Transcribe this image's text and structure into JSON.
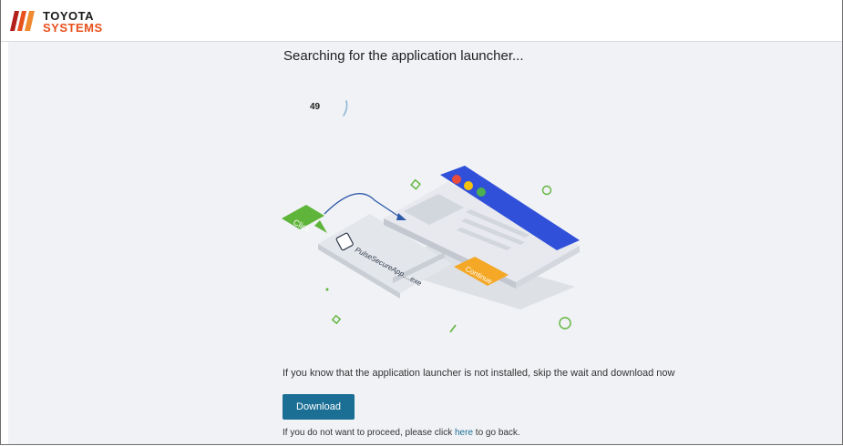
{
  "header": {
    "logo_line1": "TOYOTA",
    "logo_line2": "SYSTEMS",
    "logo_colors": {
      "mark": "#e8511c",
      "mark_dark": "#b31f1a"
    }
  },
  "main": {
    "title": "Searching for the application launcher...",
    "countdown": "49",
    "illustration": {
      "click_label": "Click",
      "file_label": "PulseSecureApp....exe",
      "continue_label": "Continue",
      "colors": {
        "window_bar": "#3150d9",
        "click_badge": "#5fb43a",
        "continue_button": "#f4a826",
        "dot_red": "#e84c3d",
        "dot_yellow": "#f4c20d",
        "dot_green": "#4caf50"
      }
    },
    "hint_text": "If you know that the application launcher is not installed, skip the wait and download now",
    "download_label": "Download",
    "back_prefix": "If you do not want to proceed, please click ",
    "back_link": "here",
    "back_suffix": " to go back."
  },
  "colors": {
    "accent": "#1b6f95",
    "page_background": "#f0f2f5"
  }
}
